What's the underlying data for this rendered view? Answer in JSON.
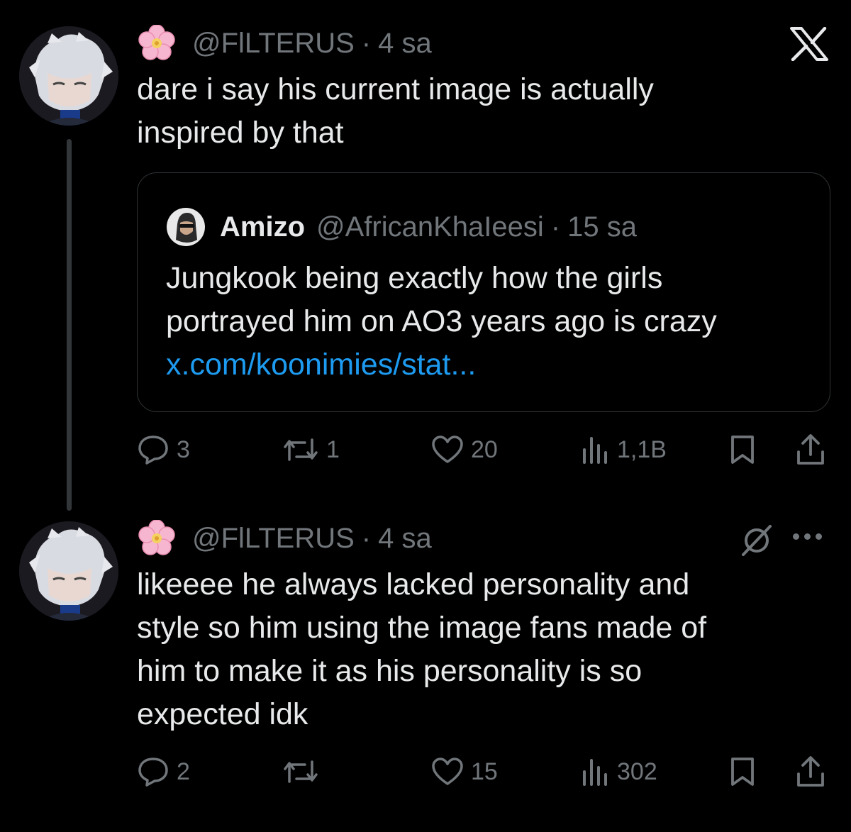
{
  "app": {
    "logo_icon": "x-logo-icon"
  },
  "colors": {
    "background": "#000000",
    "text": "#e7e9ea",
    "muted": "#71767b",
    "link": "#1d9bf0",
    "border": "#2f3336"
  },
  "tweet1": {
    "handle": "@FlLTERUS",
    "time": "4 sa",
    "text_line1": "dare i say his current image is actually",
    "text_line2": "inspired by that",
    "quote": {
      "name": "Amizo",
      "handle": "@AfricanKhaIeesi",
      "time": "15 sa",
      "text_line1": "Jungkook being exactly how the girls",
      "text_line2": "portrayed him on AO3 years ago is crazy",
      "link": "x.com/koonimies/stat..."
    },
    "actions": {
      "replies": "3",
      "reposts": "1",
      "likes": "20",
      "views": "1,1B"
    }
  },
  "tweet2": {
    "handle": "@FlLTERUS",
    "time": "4 sa",
    "text_line1": "likeeee he always lacked personality and",
    "text_line2": "style so him using the image fans made of",
    "text_line3": "him to make it as his personality is so",
    "text_line4": "expected idk",
    "actions": {
      "replies": "2",
      "reposts": "",
      "likes": "15",
      "views": "302"
    }
  },
  "separator": "·"
}
